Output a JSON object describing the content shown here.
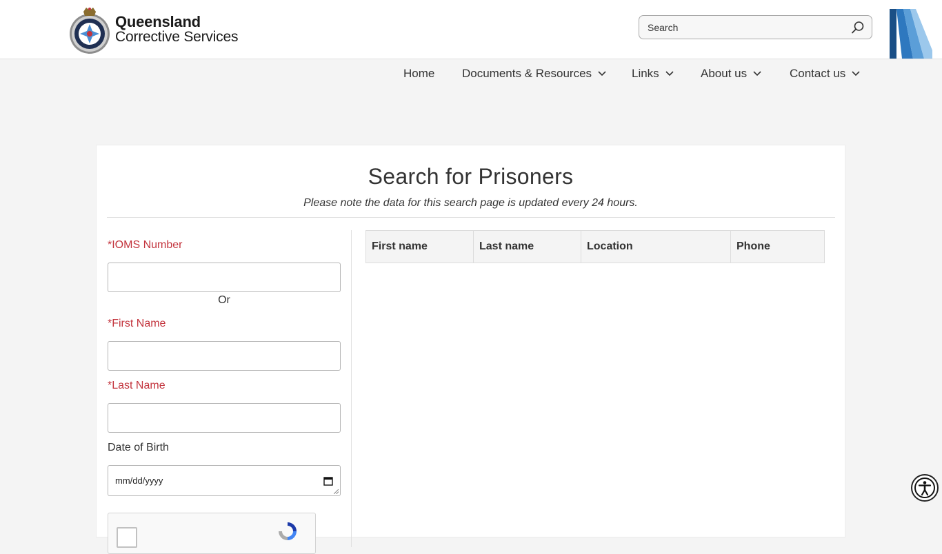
{
  "brand": {
    "line1": "Queensland",
    "line2": "Corrective Services"
  },
  "search": {
    "placeholder": "Search"
  },
  "nav": {
    "items": [
      {
        "label": "Home",
        "has_dropdown": false
      },
      {
        "label": "Documents & Resources",
        "has_dropdown": true
      },
      {
        "label": "Links",
        "has_dropdown": true
      },
      {
        "label": "About us",
        "has_dropdown": true
      },
      {
        "label": "Contact us",
        "has_dropdown": true
      }
    ]
  },
  "page": {
    "title": "Search for Prisoners",
    "subtitle": "Please note the data for this search page is updated every 24 hours."
  },
  "form": {
    "iomsLabel": "*IOMS Number",
    "iomsValue": "",
    "orText": "Or",
    "firstNameLabel": "*First Name",
    "firstNameValue": "",
    "lastNameLabel": "*Last Name",
    "lastNameValue": "",
    "dobLabel": "Date of Birth",
    "dobPlaceholder": "mm/dd/yyyy"
  },
  "table": {
    "columns": [
      "First name",
      "Last name",
      "Location",
      "Phone"
    ],
    "rows": []
  },
  "colors": {
    "required": "#c3343d",
    "brandBlueDark": "#1f5f9c",
    "brandBlueLight": "#7fb6e2"
  },
  "icons": {
    "search": "search-icon",
    "chevron": "chevron-down-icon",
    "calendar": "calendar-icon",
    "accessibility": "accessibility-icon"
  }
}
